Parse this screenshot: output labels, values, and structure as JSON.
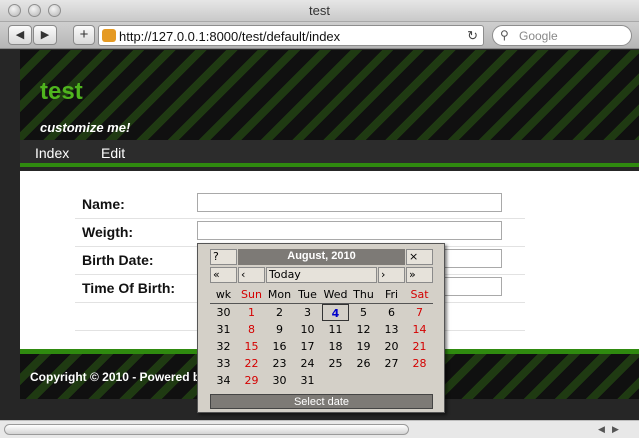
{
  "window": {
    "title": "test"
  },
  "toolbar": {
    "back_label": "◀",
    "forward_label": "▶",
    "add_label": "+",
    "url": "http://127.0.0.1:8000/test/default/index",
    "search_placeholder": "Google"
  },
  "site": {
    "title": "test",
    "slogan": "customize me!",
    "menu": [
      "Index",
      "Edit"
    ],
    "footer": "Copyright © 2010 - Powered by"
  },
  "form": {
    "fields": [
      {
        "label": "Name:",
        "value": ""
      },
      {
        "label": "Weigth:",
        "value": ""
      },
      {
        "label": "Birth Date:",
        "value": ""
      },
      {
        "label": "Time Of Birth:",
        "value": ""
      }
    ]
  },
  "calendar": {
    "help": "?",
    "month_year": "August, 2010",
    "close": "×",
    "prev_year": "«",
    "prev_month": "‹",
    "today": "Today",
    "next_month": "›",
    "next_year": "»",
    "weekday_header": [
      "wk",
      "Sun",
      "Mon",
      "Tue",
      "Wed",
      "Thu",
      "Fri",
      "Sat"
    ],
    "weeks": [
      {
        "wk": "30",
        "days": [
          "1",
          "2",
          "3",
          "4",
          "5",
          "6",
          "7"
        ]
      },
      {
        "wk": "31",
        "days": [
          "8",
          "9",
          "10",
          "11",
          "12",
          "13",
          "14"
        ]
      },
      {
        "wk": "32",
        "days": [
          "15",
          "16",
          "17",
          "18",
          "19",
          "20",
          "21"
        ]
      },
      {
        "wk": "33",
        "days": [
          "22",
          "23",
          "24",
          "25",
          "26",
          "27",
          "28"
        ]
      },
      {
        "wk": "34",
        "days": [
          "29",
          "30",
          "31",
          "",
          "",
          "",
          ""
        ]
      }
    ],
    "today_day": "4",
    "status": "Select date"
  },
  "colors": {
    "brand_green": "#4fb41e",
    "weekend_red": "#d40000",
    "today_blue": "#0000cc"
  }
}
